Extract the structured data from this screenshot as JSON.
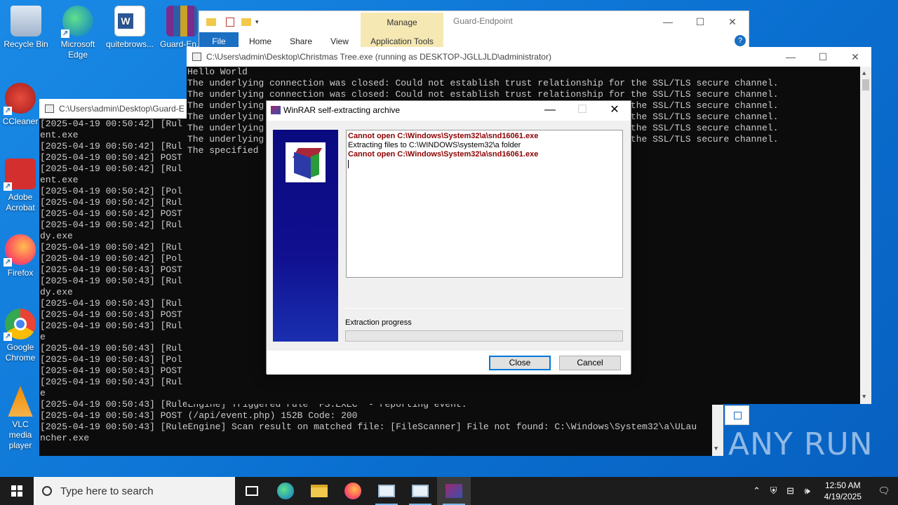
{
  "desktop_icons": [
    {
      "label": "Recycle Bin",
      "color": "#c9d7e8"
    },
    {
      "label": "Microsoft Edge",
      "color": "#1fa37a"
    },
    {
      "label": "quitebrows...",
      "color": "#2b5797"
    },
    {
      "label": "Guard-En...",
      "color": "#7a2b8c"
    },
    {
      "label": "CCleaner",
      "color": "#c0392b"
    },
    {
      "label": "Adobe Acrobat",
      "color": "#d32f2f"
    },
    {
      "label": "Firefox",
      "color": "#ff7139"
    },
    {
      "label": "Google Chrome",
      "color": "#4285f4"
    },
    {
      "label": "VLC media player",
      "color": "#f08a00"
    }
  ],
  "explorer": {
    "manage_label": "Manage",
    "window_title": "Guard-Endpoint",
    "tabs": [
      "File",
      "Home",
      "Share",
      "View"
    ],
    "app_tools_label": "Application Tools",
    "help": "?"
  },
  "console_main": {
    "title": "C:\\Users\\admin\\Desktop\\Christmas Tree.exe (running as DESKTOP-JGLLJLD\\administrator)",
    "lines": [
      "Hello World",
      "The underlying connection was closed: Could not establish trust relationship for the SSL/TLS secure channel.",
      "The underlying connection was closed: Could not establish trust relationship for the SSL/TLS secure channel.",
      "The underlying connection was closed: Could not establish trust relationship for the SSL/TLS secure channel.",
      "The underlying connection was closed: Could not establish trust relationship for the SSL/TLS secure channel.",
      "The underlying connection was closed: Could not establish trust relationship for the SSL/TLS secure channel.",
      "The underlying connection was closed: Could not establish trust relationship for the SSL/TLS secure channel.",
      "The specified"
    ]
  },
  "console_guard": {
    "title": "C:\\Users\\admin\\Desktop\\Guard-E",
    "lines": [
      "[2025-04-19 00:50:42] [Rul",
      "ent.exe",
      "[2025-04-19 00:50:42] [Rul",
      "[2025-04-19 00:50:42] POST",
      "[2025-04-19 00:50:42] [Rul",
      "ent.exe",
      "[2025-04-19 00:50:42] [Pol",
      "[2025-04-19 00:50:42] [Rul",
      "[2025-04-19 00:50:42] POST",
      "[2025-04-19 00:50:42] [Rul",
      "dy.exe",
      "[2025-04-19 00:50:42] [Rul",
      "[2025-04-19 00:50:42] [Pol",
      "[2025-04-19 00:50:43] POST",
      "[2025-04-19 00:50:43] [Rul",
      "dy.exe",
      "[2025-04-19 00:50:43] [Rul",
      "[2025-04-19 00:50:43] POST",
      "[2025-04-19 00:50:43] [Rul",
      "e",
      "[2025-04-19 00:50:43] [Rul",
      "[2025-04-19 00:50:43] [Pol",
      "[2025-04-19 00:50:43] POST",
      "[2025-04-19 00:50:43] [Rul",
      "e",
      "[2025-04-19 00:50:43] [RuleEngine] Triggered rule 'FS.EXEC' - reporting event.",
      "[2025-04-19 00:50:43] POST (/api/event.php) 152B Code: 200",
      "[2025-04-19 00:50:43] [RuleEngine] Scan result on matched file: [FileScanner] File not found: C:\\Windows\\System32\\a\\ULau",
      "ncher.exe"
    ]
  },
  "winrar": {
    "title": "WinRAR self-extracting archive",
    "log": [
      {
        "text": "Cannot open C:\\Windows\\System32\\a\\snd16061.exe",
        "kind": "err"
      },
      {
        "text": "Extracting files to C:\\WINDOWS\\system32\\a folder",
        "kind": "norm"
      },
      {
        "text": "Cannot open C:\\Windows\\System32\\a\\snd16061.exe",
        "kind": "err"
      }
    ],
    "progress_label": "Extraction progress",
    "progress_fraction": 0,
    "close_label": "Close",
    "cancel_label": "Cancel"
  },
  "taskbar": {
    "search_placeholder": "Type here to search",
    "time": "12:50 AM",
    "date": "4/19/2025"
  },
  "watermark": "ANY RUN"
}
